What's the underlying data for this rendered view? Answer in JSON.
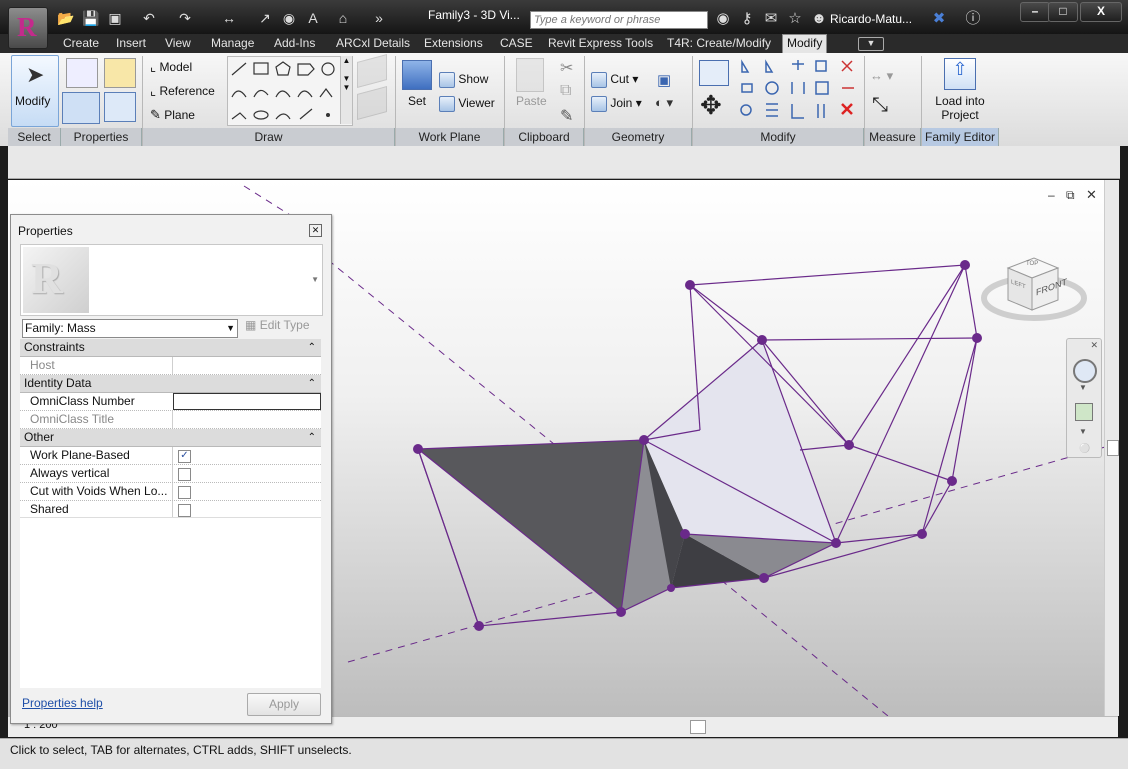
{
  "title_bar": {
    "document_title": "Family3 - 3D Vi...",
    "search_placeholder": "Type a keyword or phrase",
    "user_name": "Ricardo-Matu...",
    "app_glyph": "R"
  },
  "tabs": [
    "Create",
    "Insert",
    "View",
    "Manage",
    "Add-Ins",
    "ARCxl Details",
    "Extensions",
    "CASE",
    "Revit Express Tools",
    "T4R: Create/Modify",
    "Modify"
  ],
  "active_tab": "Modify",
  "ribbon": {
    "select": {
      "button": "Modify",
      "label": "Select"
    },
    "properties": {
      "label": "Properties"
    },
    "draw": {
      "model": "Model",
      "reference": "Reference",
      "plane": "Plane",
      "label": "Draw"
    },
    "work_plane": {
      "set": "Set",
      "show": "Show",
      "viewer": "Viewer",
      "label": "Work Plane"
    },
    "clipboard": {
      "paste": "Paste",
      "label": "Clipboard"
    },
    "geometry": {
      "cut": "Cut",
      "join": "Join",
      "label": "Geometry"
    },
    "modify": {
      "label": "Modify"
    },
    "measure": {
      "label": "Measure"
    },
    "family_editor": {
      "load_line1": "Load into",
      "load_line2": "Project",
      "label": "Family Editor"
    }
  },
  "properties_panel": {
    "title": "Properties",
    "family_selector": "Family: Mass",
    "edit_type": "Edit Type",
    "groups": [
      {
        "name": "Constraints",
        "rows": [
          {
            "key": "Host",
            "dim": true,
            "type": "text",
            "value": ""
          }
        ]
      },
      {
        "name": "Identity Data",
        "rows": [
          {
            "key": "OmniClass Number",
            "dim": false,
            "type": "input",
            "value": ""
          },
          {
            "key": "OmniClass Title",
            "dim": true,
            "type": "text",
            "value": ""
          }
        ]
      },
      {
        "name": "Other",
        "rows": [
          {
            "key": "Work Plane-Based",
            "dim": false,
            "type": "checkbox",
            "checked": true
          },
          {
            "key": "Always vertical",
            "dim": false,
            "type": "checkbox",
            "checked": false
          },
          {
            "key": "Cut with Voids When Lo...",
            "dim": false,
            "type": "checkbox",
            "checked": false
          },
          {
            "key": "Shared",
            "dim": false,
            "type": "checkbox",
            "checked": false
          }
        ]
      }
    ],
    "help_link": "Properties help",
    "apply_button": "Apply"
  },
  "view": {
    "scale": "1 : 200",
    "viewcube_face_front": "FRONT",
    "viewcube_face_left": "LEFT",
    "viewcube_face_top": "TOP"
  },
  "status_bar": {
    "message": "Click to select, TAB for alternates, CTRL adds, SHIFT unselects."
  },
  "colors": {
    "mass_edge": "#6a2a8a",
    "vertex": "#6a2a8a",
    "ribbon_label_bg": "#c9ccd1"
  }
}
